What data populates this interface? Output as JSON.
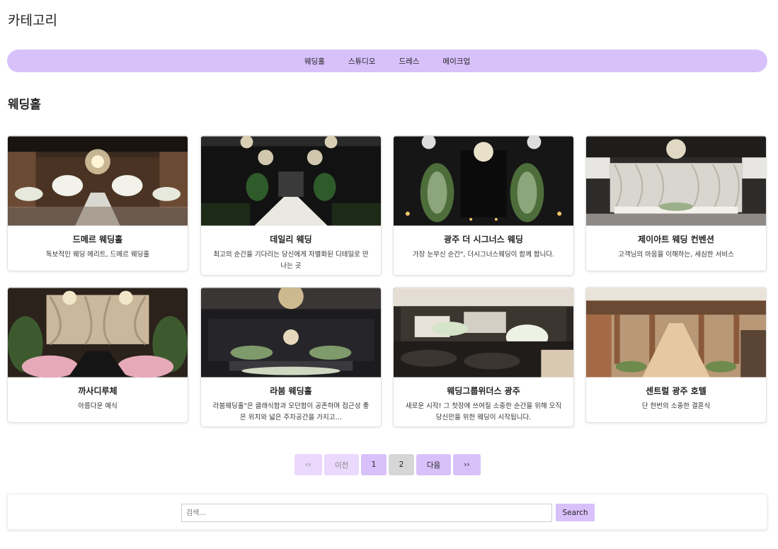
{
  "header": {
    "title": "카테고리"
  },
  "nav": {
    "items": [
      "웨딩홀",
      "스튜디오",
      "드레스",
      "메이크업"
    ]
  },
  "section": {
    "title": "웨딩홀"
  },
  "cards": [
    {
      "title": "드메르 웨딩홀",
      "desc": "독보적인 웨딩 메리트, 드메르 웨딩홀"
    },
    {
      "title": "데일리 웨딩",
      "desc": "최고의 순간을 기다리는 당신에게 차별화된 디테일로 만나는 곳"
    },
    {
      "title": "광주 더 시그너스 웨딩",
      "desc": "가장 눈부신 순간\", 더시그너스웨딩이 함께 합니다."
    },
    {
      "title": "제이아트 웨딩 컨벤션",
      "desc": "고객님의 마음을 이해하는, 세심한 서비스"
    },
    {
      "title": "까사디루체",
      "desc": "아름다운 예식"
    },
    {
      "title": "라붐 웨딩홀",
      "desc": "라붐웨딩홀\"은 클래식함과 모던함이 공존하며 접근성 좋은 위치와 넓은 주차공간을 가지고…"
    },
    {
      "title": "웨딩그룹위더스 광주",
      "desc": "새로운 시작! 그 첫장에 쓰여질 소중한 순간을 위해 오직 당신만을 위한 웨딩이 시작됩니다."
    },
    {
      "title": "센트럴 광주 호텔",
      "desc": "단 한번의 소중한 결혼식"
    }
  ],
  "pagination": {
    "first": "‹‹",
    "prev": "이전",
    "pages": [
      "1",
      "2"
    ],
    "next": "다음",
    "last": "››"
  },
  "search": {
    "placeholder": "검색...",
    "button": "Search"
  },
  "colors": {
    "accent": "#d8c1fb",
    "accent_light": "#ead9fd",
    "active_page": "#d6d6d6"
  }
}
